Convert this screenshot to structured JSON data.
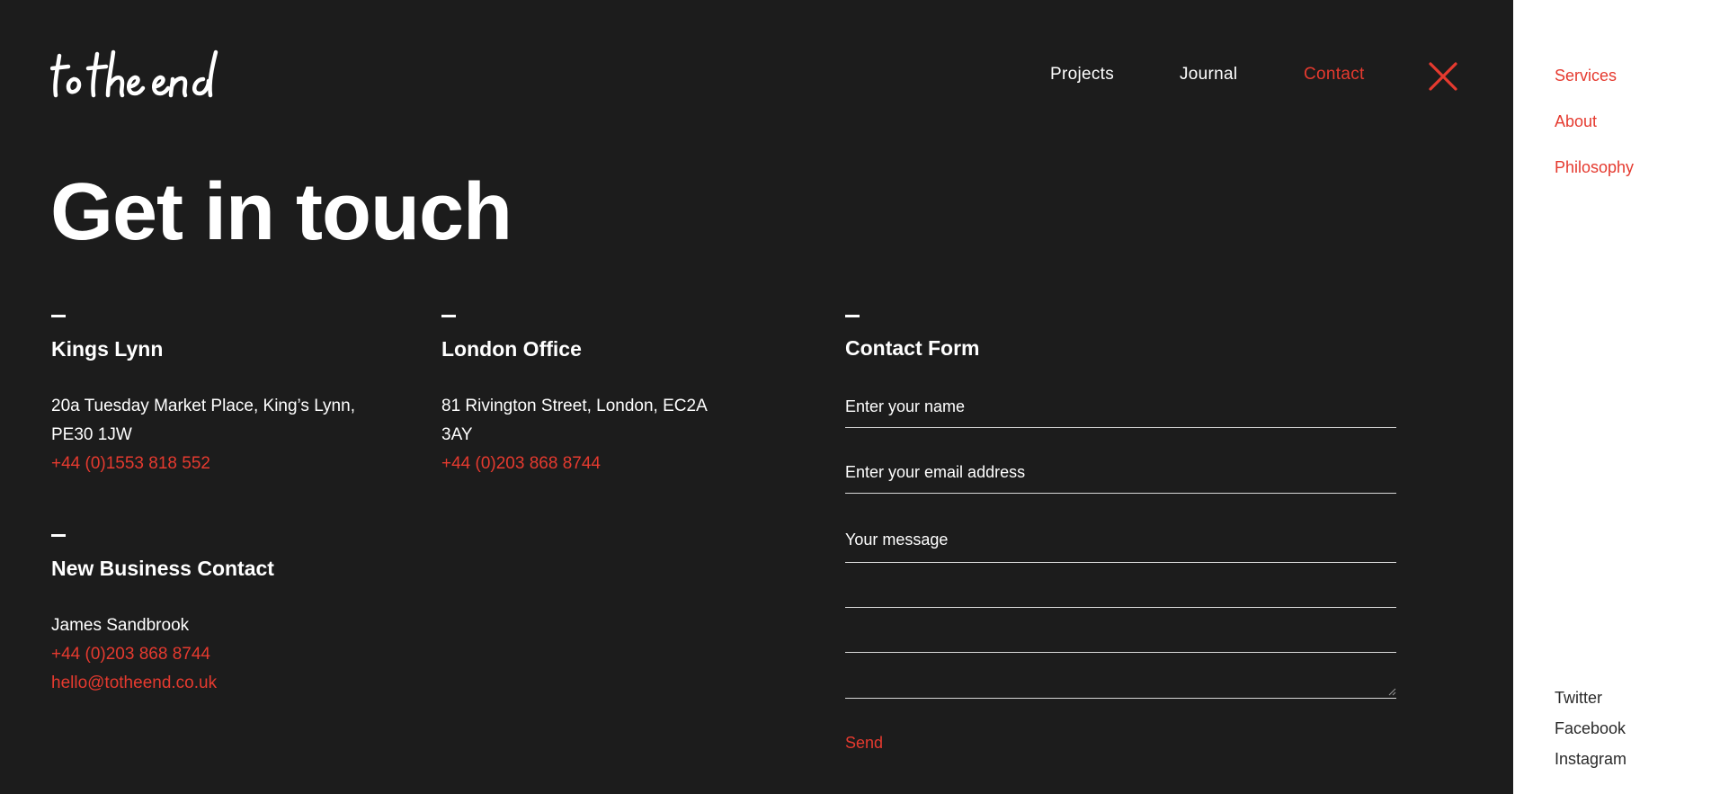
{
  "brand": {
    "logo_text": "to the end"
  },
  "nav": [
    {
      "label": "Projects"
    },
    {
      "label": "Journal"
    },
    {
      "label": "Contact",
      "active": true
    }
  ],
  "page": {
    "title": "Get in touch"
  },
  "offices": {
    "kings_lynn": {
      "title": "Kings Lynn",
      "address_line1": "20a Tuesday Market Place, King’s Lynn,",
      "address_line2": "PE30 1JW",
      "phone": "+44 (0)1553 818 552"
    },
    "london": {
      "title": "London Office",
      "address_line1": "81 Rivington Street, London, EC2A",
      "address_line2": "3AY",
      "phone": "+44 (0)203 868 8744"
    },
    "new_business": {
      "title": "New Business Contact",
      "name": "James Sandbrook",
      "phone": "+44 (0)203 868 8744",
      "email": "hello@totheend.co.uk"
    }
  },
  "form": {
    "title": "Contact Form",
    "name_placeholder": "Enter your name",
    "email_placeholder": "Enter your email address",
    "message_label": "Your message",
    "send_label": "Send"
  },
  "sidebar": {
    "links": [
      {
        "label": "Services"
      },
      {
        "label": "About"
      },
      {
        "label": "Philosophy"
      }
    ],
    "social": [
      {
        "label": "Twitter"
      },
      {
        "label": "Facebook"
      },
      {
        "label": "Instagram"
      }
    ]
  },
  "colors": {
    "accent": "#e53a2f",
    "background": "#1c1c1c",
    "panel": "#ffffff"
  }
}
